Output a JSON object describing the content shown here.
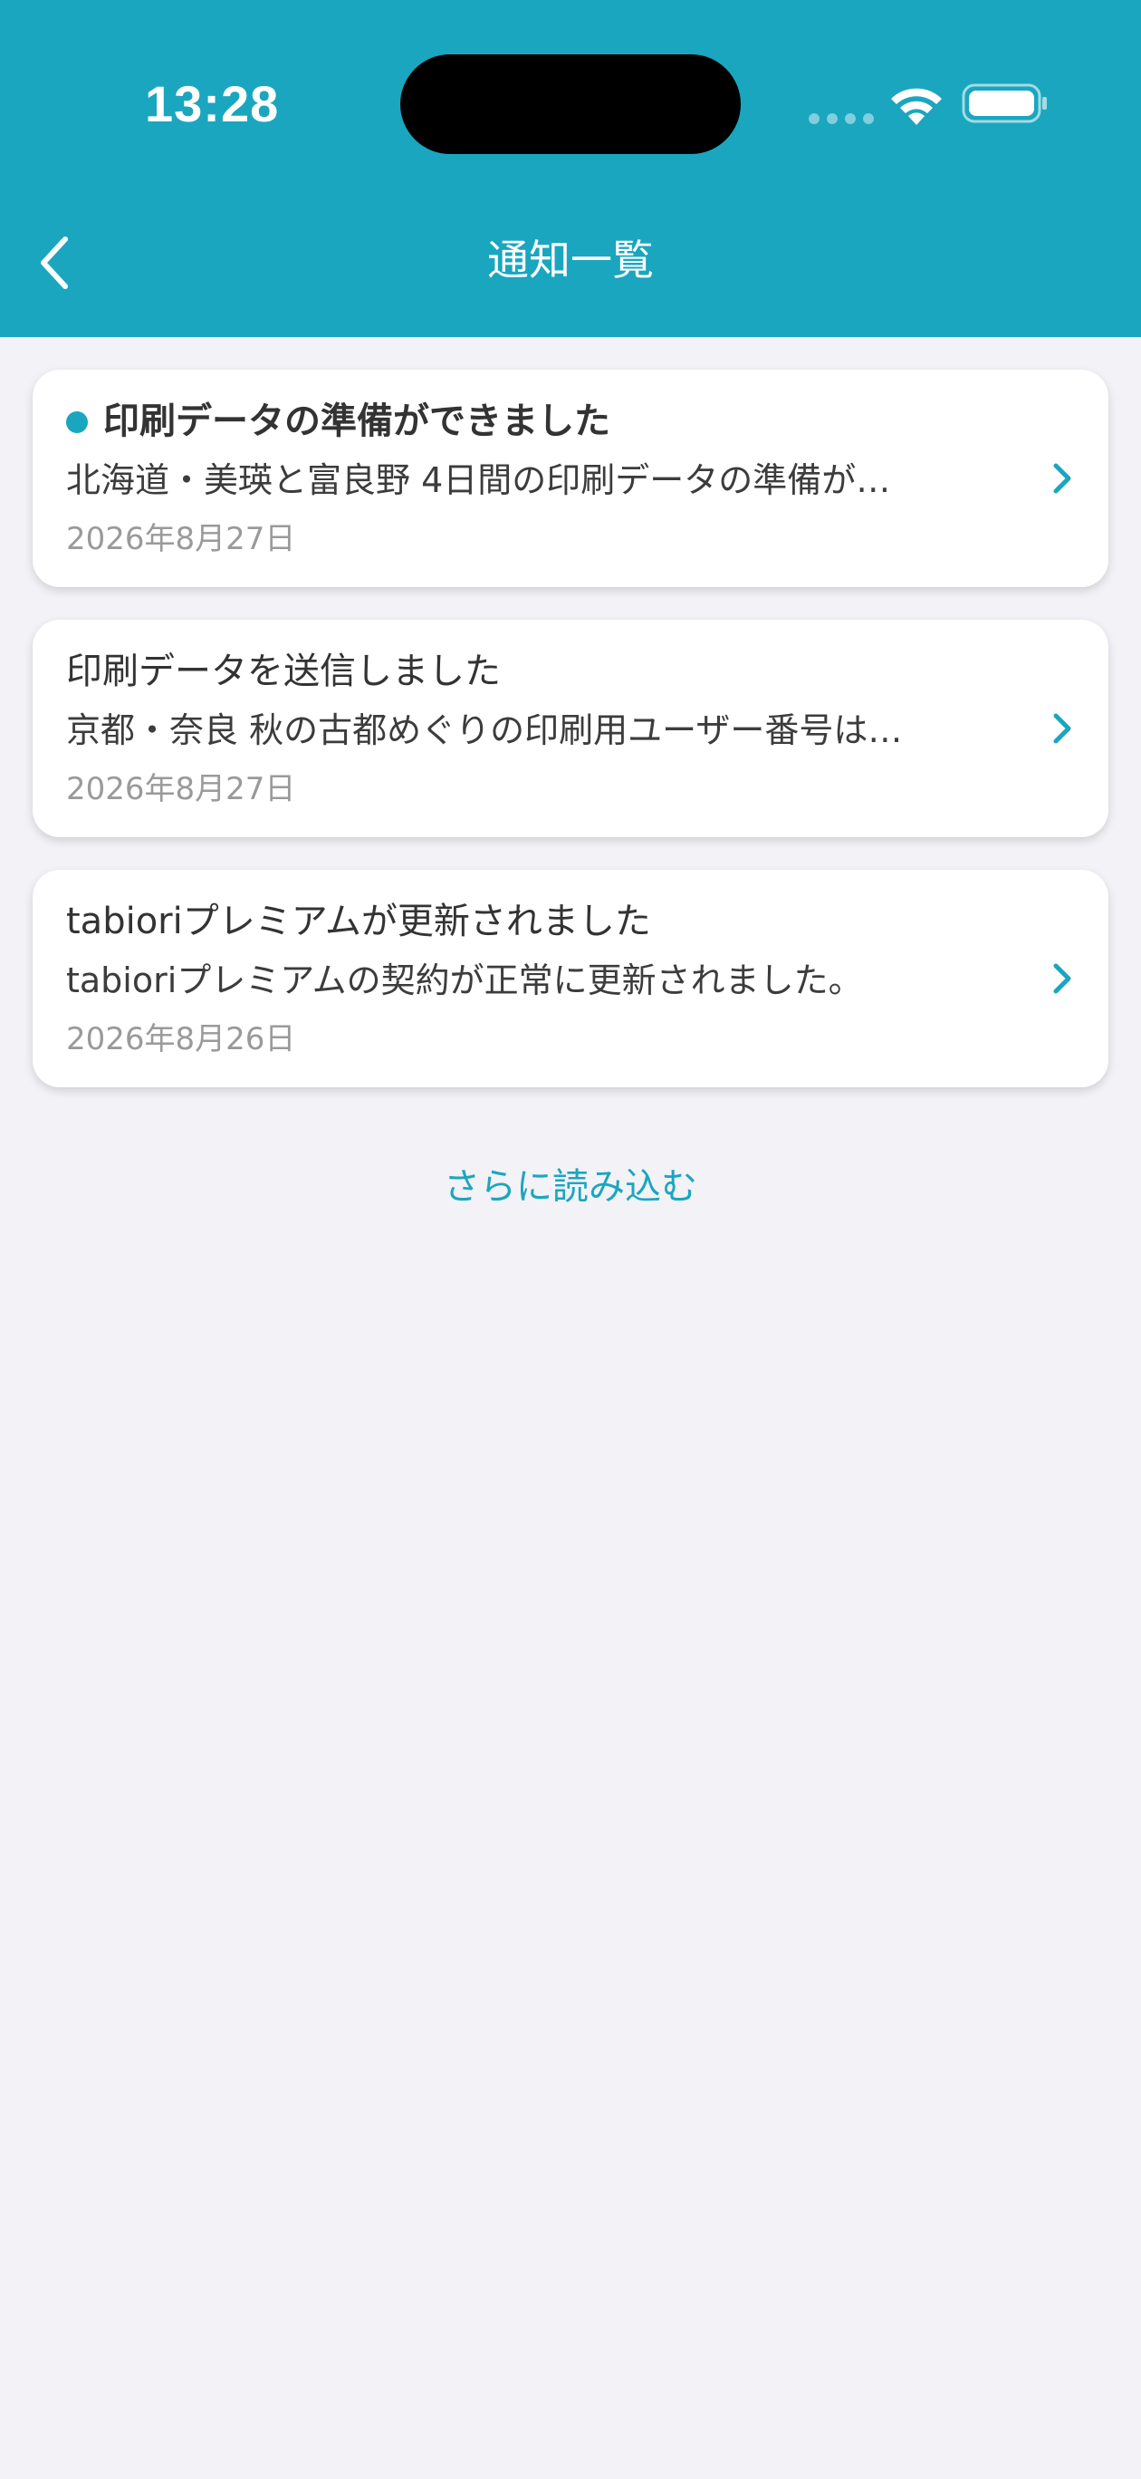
{
  "status_bar": {
    "time": "13:28"
  },
  "nav": {
    "title": "通知一覧"
  },
  "notifications": [
    {
      "title": "印刷データの準備ができました",
      "body": "北海道・美瑛と富良野 4日間の印刷データの準備が…",
      "date": "2026年8月27日",
      "unread": true
    },
    {
      "title": "印刷データを送信しました",
      "body": "京都・奈良 秋の古都めぐりの印刷用ユーザー番号は…",
      "date": "2026年8月27日",
      "unread": false
    },
    {
      "title": "tabioriプレミアムが更新されました",
      "body": "tabioriプレミアムの契約が正常に更新されました。",
      "date": "2026年8月26日",
      "unread": false
    }
  ],
  "load_more_label": "さらに読み込む",
  "colors": {
    "accent": "#1aa6bf",
    "background": "#f2f2f7",
    "card": "#ffffff"
  },
  "icons": {
    "back": "chevron-left-icon",
    "row": "chevron-right-icon",
    "unread": "dot-icon"
  }
}
